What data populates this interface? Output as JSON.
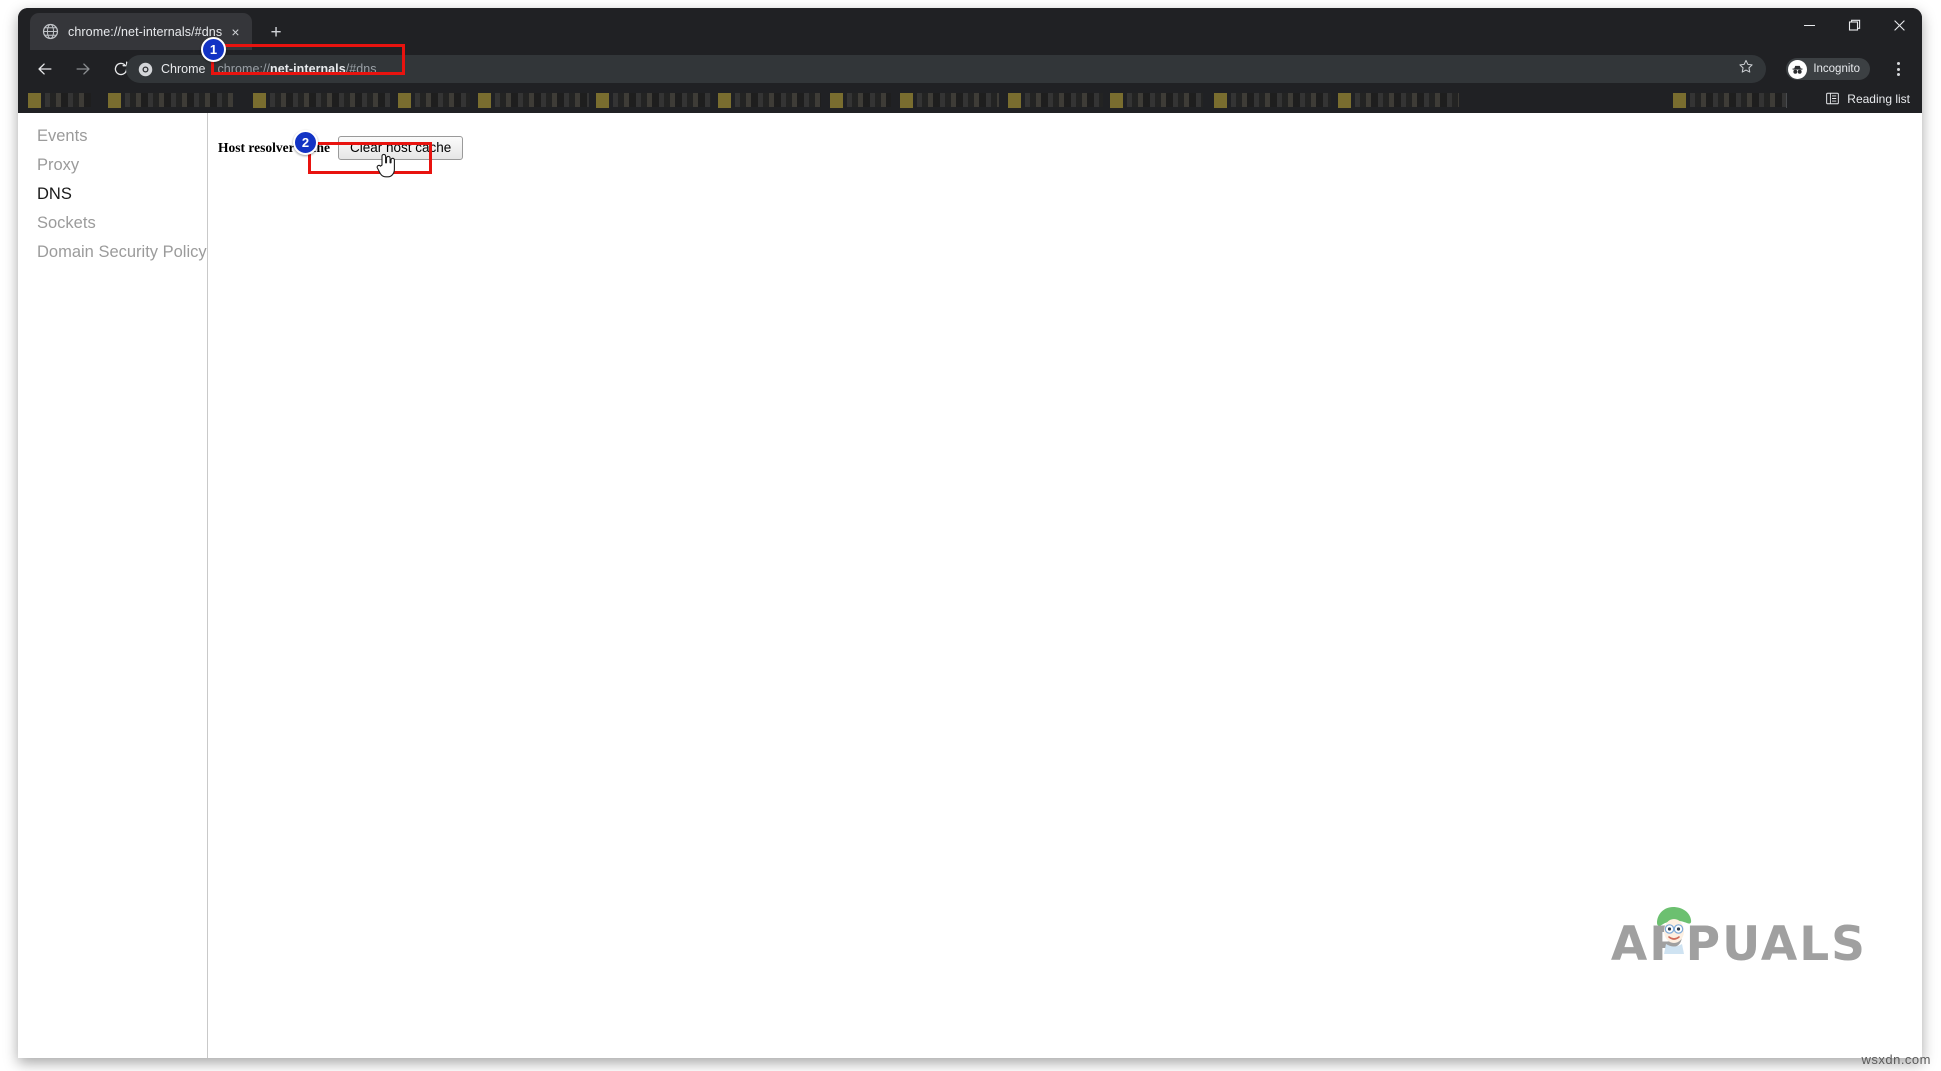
{
  "window": {
    "controls": [
      {
        "name": "minimize",
        "glyph": "minimize-icon"
      },
      {
        "name": "maximize",
        "glyph": "maximize-icon"
      },
      {
        "name": "close",
        "glyph": "close-icon"
      }
    ]
  },
  "tabs": [
    {
      "title": "chrome://net-internals/#dns",
      "favicon": "globe-icon",
      "active": true
    }
  ],
  "new_tab_label": "+",
  "tab_close_label": "×",
  "toolbar": {
    "back_icon": "back-arrow-icon",
    "forward_icon": "forward-arrow-icon",
    "reload_icon": "reload-icon",
    "omnibox": {
      "chip_label": "Chrome",
      "chip_icon": "chrome-logo-icon",
      "url_prefix": "chrome://",
      "url_host": "net-internals",
      "url_suffix": "/#dns",
      "full_url": "chrome://net-internals/#dns",
      "star_icon": "bookmark-star-icon"
    },
    "incognito_label": "Incognito",
    "incognito_icon": "incognito-icon",
    "menu_icon": "three-dot-menu-icon"
  },
  "bookmarks_bar": {
    "items_redacted": true,
    "item_count": 14,
    "reading_list_label": "Reading list",
    "reading_list_icon": "reading-list-icon"
  },
  "sidebar": {
    "items": [
      {
        "label": "Events",
        "active": false
      },
      {
        "label": "Proxy",
        "active": false
      },
      {
        "label": "DNS",
        "active": true
      },
      {
        "label": "Sockets",
        "active": false
      },
      {
        "label": "Domain Security Policy",
        "active": false
      }
    ]
  },
  "content": {
    "host_resolver_label": "Host resolver cache",
    "clear_button_label": "Clear host cache"
  },
  "annotations": {
    "highlight_color": "#e8130f",
    "badge_color": "#1233c4",
    "steps": [
      {
        "number": "1",
        "target": "omnibox-url"
      },
      {
        "number": "2",
        "target": "clear-host-cache-button"
      }
    ],
    "cursor": "hand-pointer-cursor"
  },
  "watermark": {
    "brand": "APPUALS",
    "site_credit": "wsxdn.com"
  }
}
